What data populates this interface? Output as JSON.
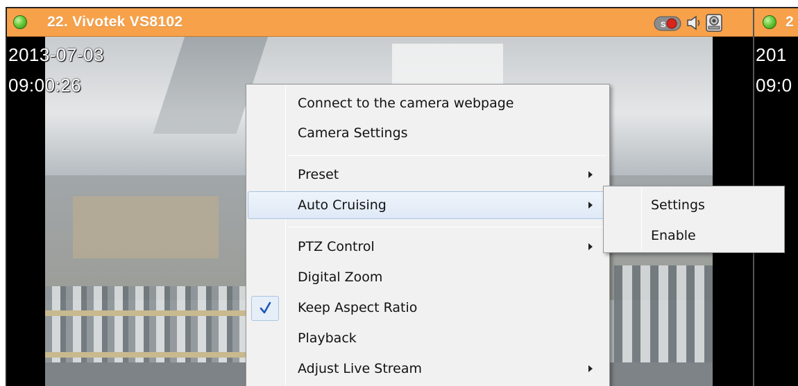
{
  "camera_panel": {
    "title": "22. Vivotek VS8102",
    "status_color": "#5fc23a",
    "titlebar_color": "#f7a14a",
    "osd_date": "2013-07-03",
    "osd_time": "09:00:26",
    "icons": [
      "record-icon",
      "speaker-icon",
      "ptz-camera-icon"
    ]
  },
  "second_panel": {
    "title": "2",
    "osd_date": "201",
    "osd_time": "09:0"
  },
  "context_menu": {
    "items": [
      {
        "label": "Connect to the camera webpage",
        "submenu": false
      },
      {
        "label": "Camera Settings",
        "submenu": false
      },
      {
        "label": "Preset",
        "submenu": true
      },
      {
        "label": "Auto Cruising",
        "submenu": true,
        "highlighted": true
      },
      {
        "label": "PTZ Control",
        "submenu": true
      },
      {
        "label": "Digital Zoom",
        "submenu": false
      },
      {
        "label": "Keep Aspect Ratio",
        "submenu": false,
        "checked": true
      },
      {
        "label": "Playback",
        "submenu": false
      },
      {
        "label": "Adjust Live Stream",
        "submenu": true
      }
    ]
  },
  "auto_cruising_submenu": {
    "items": [
      {
        "label": "Settings"
      },
      {
        "label": "Enable"
      }
    ]
  },
  "colors": {
    "highlight": "#dfe9f6",
    "checkmark": "#1b57b8"
  }
}
